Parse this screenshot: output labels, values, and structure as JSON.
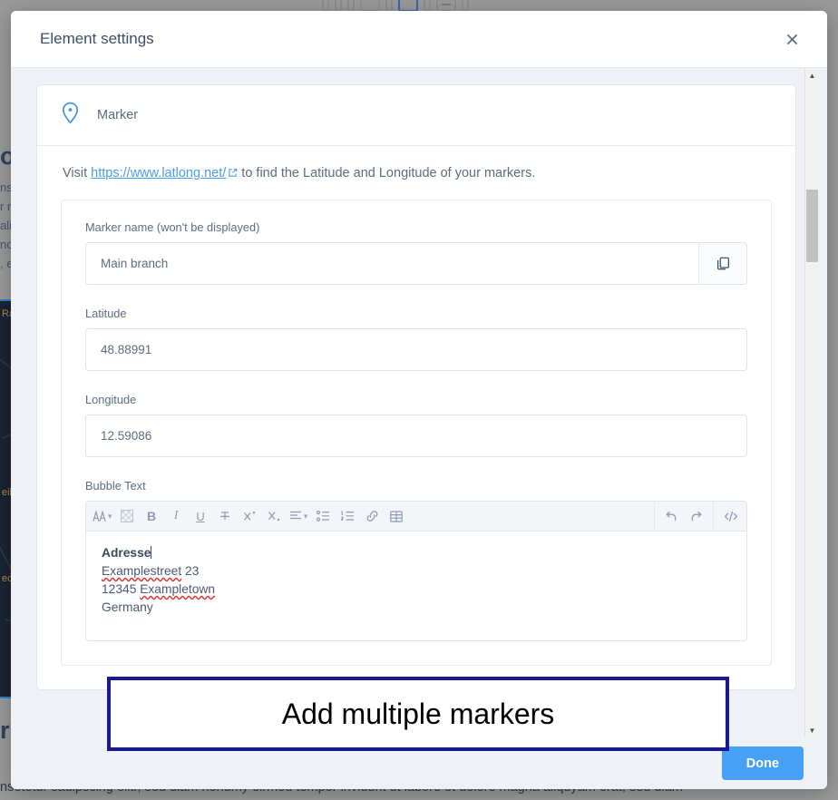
{
  "background": {
    "heading": "on",
    "paragraph_lines": [
      "ns",
      "r ri",
      "ali",
      "nci",
      ", e"
    ],
    "map_labels": [
      "Ra",
      "eil",
      "ec"
    ],
    "heading2": "r",
    "bottom_text": "nsetetur sadipscing elitr, sed diam nonumy eirmod tempor invidunt ut labore et dolore magna aliquyam erat, sed diam"
  },
  "modal": {
    "title": "Element settings",
    "close_icon": "close-icon",
    "marker_section": {
      "icon": "map-pin-icon",
      "label": "Marker"
    },
    "hint": {
      "prefix": "Visit ",
      "link_text": "https://www.latlong.net/",
      "link_icon": "external-link-icon",
      "suffix": " to find the Latitude and Longitude of your markers."
    },
    "fields": {
      "marker_name": {
        "label": "Marker name (won't be displayed)",
        "value": "Main branch",
        "copy_icon": "copy-icon"
      },
      "latitude": {
        "label": "Latitude",
        "value": "48.88991"
      },
      "longitude": {
        "label": "Longitude",
        "value": "12.59086"
      },
      "bubble_text": {
        "label": "Bubble Text",
        "content": {
          "line1": "Adresse",
          "line2_spell": "Examplestreet",
          "line2_rest": " 23",
          "line3_num": "12345 ",
          "line3_spell": "Exampletown",
          "line4": "Germany"
        }
      }
    },
    "editor_toolbar": {
      "left_buttons": [
        {
          "name": "font-family-icon",
          "glyph": "A",
          "chevron": true
        },
        {
          "name": "text-color-icon",
          "glyph": "",
          "chevron": false
        },
        {
          "name": "bold-icon",
          "glyph": "B",
          "chevron": false
        },
        {
          "name": "italic-icon",
          "glyph": "I",
          "chevron": false
        },
        {
          "name": "underline-icon",
          "glyph": "U",
          "chevron": false
        },
        {
          "name": "strikethrough-icon",
          "glyph": "T",
          "chevron": false
        },
        {
          "name": "superscript-icon",
          "glyph": "X",
          "chevron": false
        },
        {
          "name": "subscript-icon",
          "glyph": "X",
          "chevron": false
        },
        {
          "name": "align-icon",
          "glyph": "",
          "chevron": true
        },
        {
          "name": "bulleted-list-icon",
          "glyph": "",
          "chevron": false
        },
        {
          "name": "numbered-list-icon",
          "glyph": "",
          "chevron": false
        },
        {
          "name": "link-icon",
          "glyph": "",
          "chevron": false
        },
        {
          "name": "table-icon",
          "glyph": "",
          "chevron": false
        }
      ],
      "right_buttons": [
        {
          "name": "undo-icon"
        },
        {
          "name": "redo-icon"
        },
        {
          "name": "code-view-icon"
        }
      ]
    },
    "footer": {
      "done_label": "Done"
    },
    "scrollbar": {
      "up_arrow": "▲",
      "down_arrow": "▼"
    }
  },
  "annotation": {
    "text": "Add multiple markers",
    "border_color": "#1a1a8c"
  },
  "colors": {
    "accent": "#46a0f5",
    "link": "#4a9de8",
    "marker_icon": "#3f95de",
    "text": "#5c6c80"
  }
}
